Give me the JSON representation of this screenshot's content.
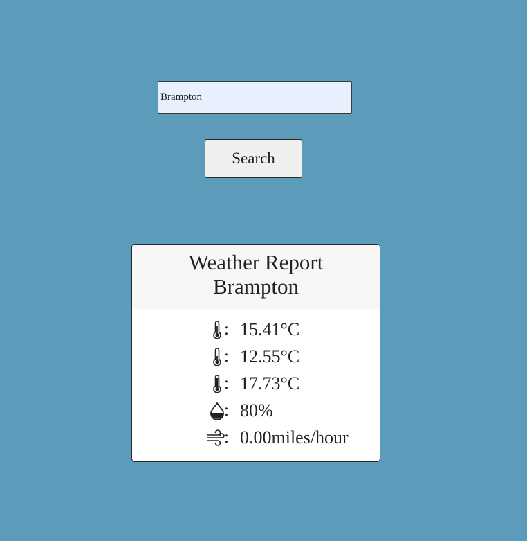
{
  "search": {
    "value": "Brampton",
    "button_label": "Search"
  },
  "report": {
    "title": "Weather Report",
    "city": "Brampton",
    "rows": [
      {
        "icon": "thermometer-icon",
        "value": "15.41°C"
      },
      {
        "icon": "thermometer-icon",
        "value": "12.55°C"
      },
      {
        "icon": "thermometer-icon",
        "value": "17.73°C"
      },
      {
        "icon": "humidity-drop-icon",
        "value": "80%"
      },
      {
        "icon": "wind-icon",
        "value": "0.00miles/hour"
      }
    ],
    "separator": ":"
  },
  "colors": {
    "background": "#5c9bb9",
    "input_background": "#e8f0fe",
    "card_header": "#f7f7f7"
  }
}
